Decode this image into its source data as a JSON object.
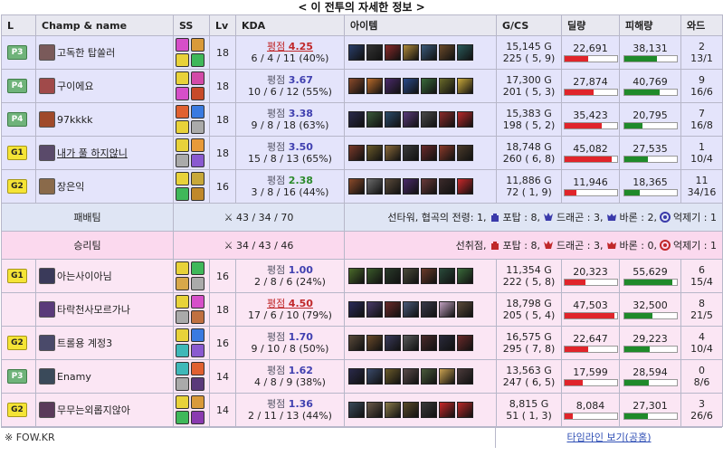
{
  "title": "< 이 전투의 자세한 정보 >",
  "headers": [
    "L",
    "Champ & name",
    "SS",
    "Lv",
    "KDA",
    "아이템",
    "G/CS",
    "딜량",
    "피해량",
    "와드"
  ],
  "bar_max": {
    "dmg": 50000,
    "taken": 60000
  },
  "losing_team": {
    "label": "패배팀",
    "kda": "43 / 34 / 70",
    "objectives_text": "선타워, 협곡의 전령: 1,",
    "baron_dragon": [
      "포탑 : 8,",
      "드래곤 : 3,",
      "바론 : 2,",
      "억제기 : 1"
    ],
    "color": "#3a3aaa"
  },
  "winning_team": {
    "label": "승리팀",
    "kda": "34 / 43 / 46",
    "objectives_text": "선취점,",
    "baron_dragon": [
      "포탑 : 8,",
      "드래곤 : 3,",
      "바론 : 0,",
      "억제기 : 1"
    ],
    "color": "#c0282a"
  },
  "loss_players": [
    {
      "tier": "P3",
      "tier_class": "P",
      "name": "고독한 탑쏠러",
      "name_underline": false,
      "lv": "18",
      "grade_label": "평점",
      "grade": "4.25",
      "grade_style": "best",
      "kda": "6 / 4 / 11 (40%)",
      "gold": "15,145 G",
      "cs": "225 ( 5, 9)",
      "dmg": 22691,
      "dmg_text": "22,691",
      "taken": 38131,
      "taken_text": "38,131",
      "ward_a": "2",
      "ward_b": "13/1",
      "spells": [
        "#d64fc9",
        "#d99a3a",
        "#e8d23a",
        "#3fb85a"
      ],
      "items": [
        "#2a3e6a",
        "#333",
        "#8a2a2a",
        "#b08a3a",
        "#3a5a7a",
        "#6a4a2a",
        "#2a5a5a"
      ],
      "face": "#7a5a5a"
    },
    {
      "tier": "P4",
      "tier_class": "P",
      "name": "구이에요",
      "name_underline": false,
      "lv": "18",
      "grade_label": "평점",
      "grade": "3.67",
      "grade_style": "",
      "kda": "10 / 6 / 12 (55%)",
      "gold": "17,300 G",
      "cs": "201 ( 5, 3)",
      "dmg": 27874,
      "dmg_text": "27,874",
      "taken": 40769,
      "taken_text": "40,769",
      "ward_a": "9",
      "ward_b": "16/6",
      "spells": [
        "#e8d23a",
        "#d24aa8",
        "#d64fc9",
        "#c74a2a"
      ],
      "items": [
        "#8a4a2a",
        "#b86a2a",
        "#4a2a6a",
        "#2a4a8a",
        "#3a6a3a",
        "#6a6a2a",
        "#c8a83a"
      ],
      "face": "#a04a4a"
    },
    {
      "tier": "P4",
      "tier_class": "P",
      "name": "97kkkk",
      "name_underline": false,
      "lv": "18",
      "grade_label": "평점",
      "grade": "3.38",
      "grade_style": "",
      "kda": "9 / 8 / 18 (63%)",
      "gold": "15,383 G",
      "cs": "198 ( 5, 2)",
      "dmg": 35423,
      "dmg_text": "35,423",
      "taken": 20795,
      "taken_text": "20,795",
      "ward_a": "7",
      "ward_b": "16/8",
      "spells": [
        "#e06030",
        "#3a7ae0",
        "#e8d23a",
        "#aaaaaa"
      ],
      "items": [
        "#2a2a4a",
        "#3a5a3a",
        "#2a4a6a",
        "#5a3a7a",
        "#4a4a4a",
        "#8a2a2a",
        "#b8282a"
      ],
      "face": "#a04a2a"
    },
    {
      "tier": "G1",
      "tier_class": "G",
      "name": "내가 풀 하지않니",
      "name_underline": true,
      "lv": "18",
      "grade_label": "평점",
      "grade": "3.50",
      "grade_style": "",
      "kda": "15 / 8 / 13 (65%)",
      "gold": "18,748 G",
      "cs": "260 ( 6, 8)",
      "dmg": 45082,
      "dmg_text": "45,082",
      "taken": 27535,
      "taken_text": "27,535",
      "ward_a": "1",
      "ward_b": "10/4",
      "spells": [
        "#e8d23a",
        "#e89a3a",
        "#aaaaaa",
        "#8a5ad0"
      ],
      "items": [
        "#7a3a2a",
        "#6a5a2a",
        "#8a6a3a",
        "#3a3a3a",
        "#6a2a2a",
        "#8a3a2a",
        "#4a3a2a"
      ],
      "face": "#5a4a6a"
    },
    {
      "tier": "G2",
      "tier_class": "G",
      "name": "장은익",
      "name_underline": false,
      "lv": "16",
      "grade_label": "평점",
      "grade": "2.38",
      "grade_style": "good",
      "kda": "3 / 8 / 16 (44%)",
      "gold": "11,886 G",
      "cs": "72 ( 1, 9)",
      "dmg": 11946,
      "dmg_text": "11,946",
      "taken": 18365,
      "taken_text": "18,365",
      "ward_a": "11",
      "ward_b": "34/16",
      "spells": [
        "#e8d23a",
        "#c8a83a",
        "#3fb85a",
        "#c0882a"
      ],
      "items": [
        "#8a4a2a",
        "#6a6a6a",
        "#5a4a3a",
        "#4a2a6a",
        "#6a3a3a",
        "#3a2a2a",
        "#c8282a"
      ],
      "face": "#8a6a4a"
    }
  ],
  "win_players": [
    {
      "tier": "G1",
      "tier_class": "G",
      "name": "아는사이아님",
      "name_underline": false,
      "lv": "16",
      "grade_label": "평점",
      "grade": "1.00",
      "grade_style": "",
      "kda": "2 / 8 / 6 (24%)",
      "gold": "11,354 G",
      "cs": "222 ( 5, 8)",
      "dmg": 20323,
      "dmg_text": "20,323",
      "taken": 55629,
      "taken_text": "55,629",
      "ward_a": "6",
      "ward_b": "15/4",
      "spells": [
        "#e8d23a",
        "#3fb85a",
        "#d8a84a",
        "#aaaaaa"
      ],
      "items": [
        "#4a6a2a",
        "#3a5a2a",
        "#2a3a2a",
        "#4a4a3a",
        "#6a3a2a",
        "#2a4a3a",
        "#3a6a3a"
      ],
      "face": "#3a3a5a"
    },
    {
      "tier": "",
      "tier_class": "",
      "name": "타락천사모르가나",
      "name_underline": false,
      "lv": "18",
      "grade_label": "평점",
      "grade": "4.50",
      "grade_style": "best",
      "kda": "17 / 6 / 10 (79%)",
      "gold": "18,798 G",
      "cs": "205 ( 5, 4)",
      "dmg": 47503,
      "dmg_text": "47,503",
      "taken": 32500,
      "taken_text": "32,500",
      "ward_a": "8",
      "ward_b": "21/5",
      "spells": [
        "#e8d23a",
        "#d64fc9",
        "#aaaaaa",
        "#c07040"
      ],
      "items": [
        "#2a2a5a",
        "#4a3a6a",
        "#6a2a2a",
        "#4a5a7a",
        "#3a3a4a",
        "#c0a0c0",
        "#5a4a3a"
      ],
      "face": "#5a3a7a"
    },
    {
      "tier": "G2",
      "tier_class": "G",
      "name": "트롤용 계정3",
      "name_underline": false,
      "lv": "16",
      "grade_label": "평점",
      "grade": "1.70",
      "grade_style": "",
      "kda": "9 / 10 / 8 (50%)",
      "gold": "16,575 G",
      "cs": "295 ( 7, 8)",
      "dmg": 22647,
      "dmg_text": "22,647",
      "taken": 29223,
      "taken_text": "29,223",
      "ward_a": "4",
      "ward_b": "10/4",
      "spells": [
        "#e8d23a",
        "#3a7ae0",
        "#3fb8b8",
        "#8a5ad0"
      ],
      "items": [
        "#5a4a3a",
        "#6a4a2a",
        "#3a3a5a",
        "#5a5a5a",
        "#4a2a2a",
        "#2a2a3a",
        "#6a2a2a"
      ],
      "face": "#4a4a6a"
    },
    {
      "tier": "P3",
      "tier_class": "P",
      "name": "Enamy",
      "name_underline": false,
      "lv": "14",
      "grade_label": "평점",
      "grade": "1.62",
      "grade_style": "",
      "kda": "4 / 8 / 9 (38%)",
      "gold": "13,563 G",
      "cs": "247 ( 6, 5)",
      "dmg": 17599,
      "dmg_text": "17,599",
      "taken": 28594,
      "taken_text": "28,594",
      "ward_a": "0",
      "ward_b": "8/6",
      "spells": [
        "#3fb8b8",
        "#e06030",
        "#aaaaaa",
        "#5a3a7a"
      ],
      "items": [
        "#2a2a4a",
        "#3a4a6a",
        "#6a5a2a",
        "#5a4a4a",
        "#4a5a3a",
        "#c8a050",
        "#4a3a3a"
      ],
      "face": "#3a4a5a"
    },
    {
      "tier": "G2",
      "tier_class": "G",
      "name": "무무는외롭지않아",
      "name_underline": false,
      "lv": "14",
      "grade_label": "평점",
      "grade": "1.36",
      "grade_style": "",
      "kda": "2 / 11 / 13 (44%)",
      "gold": "8,815 G",
      "cs": "51 ( 1, 3)",
      "dmg": 8084,
      "dmg_text": "8,084",
      "taken": 27301,
      "taken_text": "27,301",
      "ward_a": "3",
      "ward_b": "26/6",
      "spells": [
        "#e8d23a",
        "#d99a3a",
        "#3fb85a",
        "#8a3ab0"
      ],
      "items": [
        "#3a4a5a",
        "#6a5a4a",
        "#8a7a4a",
        "#5a4a2a",
        "#3a3a3a",
        "#c8282a",
        "#b8282a"
      ],
      "face": "#5a3a5a"
    }
  ],
  "footer": {
    "source": "※ FOW.KR",
    "timeline_link": "타임라인 보기(공홈)"
  }
}
